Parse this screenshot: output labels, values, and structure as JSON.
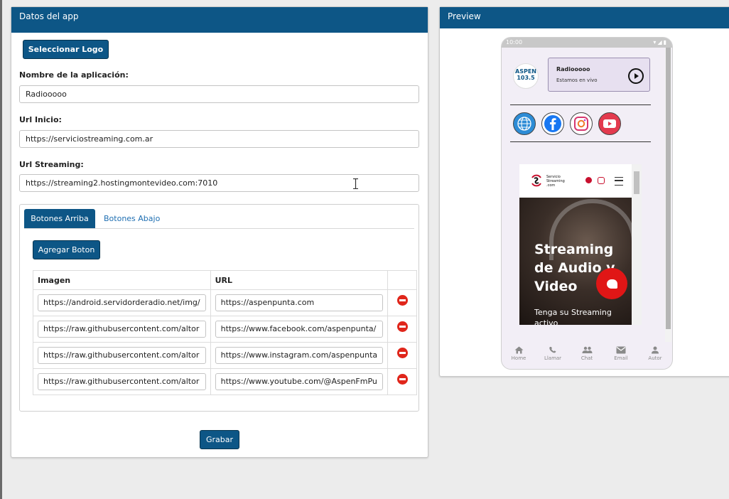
{
  "form": {
    "title": "Datos del app",
    "logo_button": "Seleccionar Logo",
    "name_label": "Nombre de la aplicación:",
    "name_value": "Radiooooo",
    "url_inicio_label": "Url Inicio:",
    "url_inicio_value": "https://serviciostreaming.com.ar",
    "url_streaming_label": "Url Streaming:",
    "url_streaming_value": "https://streaming2.hostingmontevideo.com:7010",
    "tabs": [
      "Botones Arriba",
      "Botones Abajo"
    ],
    "add_button": "Agregar Boton",
    "table": {
      "headers": [
        "Imagen",
        "URL"
      ],
      "rows": [
        {
          "image": "https://android.servidorderadio.net/img/",
          "url": "https://aspenpunta.com"
        },
        {
          "image": "https://raw.githubusercontent.com/altor",
          "url": "https://www.facebook.com/aspenpunta/"
        },
        {
          "image": "https://raw.githubusercontent.com/altor",
          "url": "https://www.instagram.com/aspenpunta"
        },
        {
          "image": "https://raw.githubusercontent.com/altor",
          "url": "https://www.youtube.com/@AspenFmPu"
        }
      ]
    },
    "save_button": "Grabar"
  },
  "preview": {
    "title": "Preview",
    "status_time": "10:00",
    "logo_text": "ASPEN 103.5",
    "player": {
      "title": "Radiooooo",
      "subtitle": "Estamos en vivo"
    },
    "social_icons": [
      "globe-icon",
      "facebook-icon",
      "instagram-icon",
      "youtube-icon"
    ],
    "site": {
      "brand": "Servicio Streaming .com",
      "hero_title": "Streaming de Audio y Video",
      "hero_sub": "Tenga su Streaming activo"
    },
    "nav": [
      "Home",
      "Llamar",
      "Chat",
      "Email",
      "Autor"
    ]
  },
  "colors": {
    "primary": "#0d5686",
    "danger": "#e0261b",
    "tab_link": "#1f6fb2"
  }
}
